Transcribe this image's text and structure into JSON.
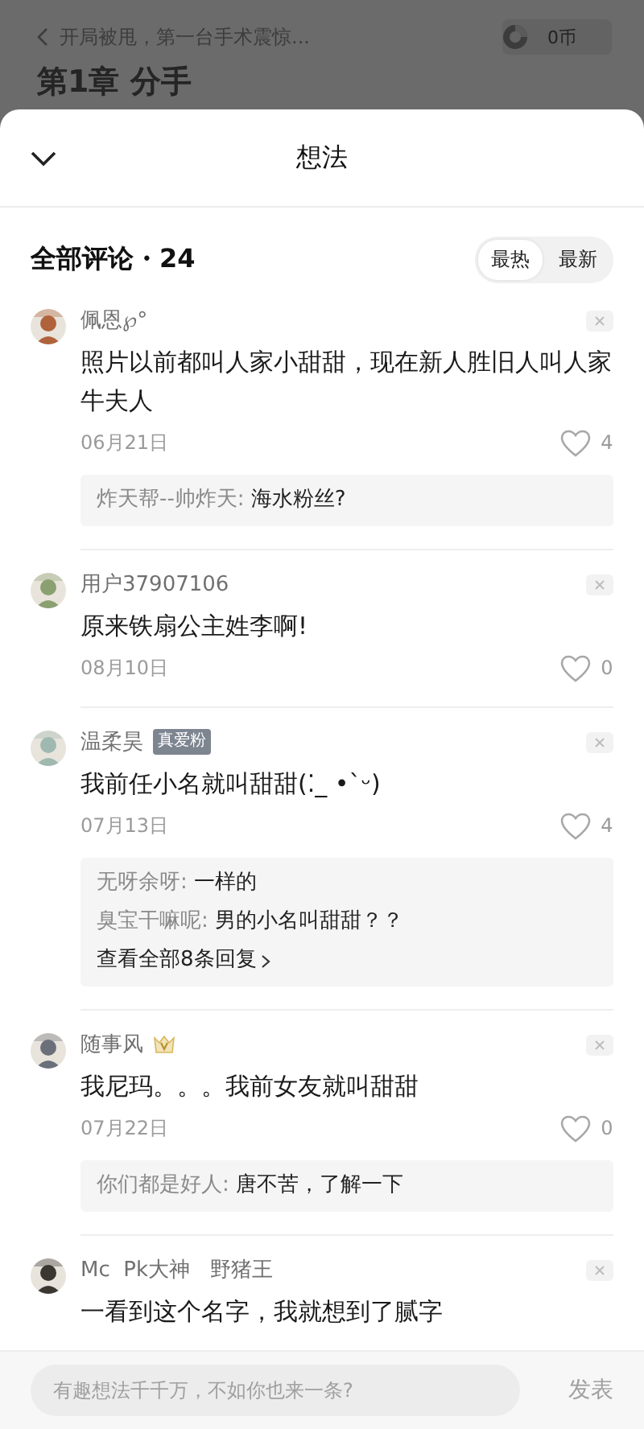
{
  "background": {
    "book_title": "开局被甩，第一台手术震惊...",
    "coins": "0币",
    "chapter_title": "第1章 分手"
  },
  "sheet": {
    "title": "想法",
    "section_title": "全部评论・24",
    "sort_tabs": [
      {
        "label": "最热",
        "selected": true
      },
      {
        "label": "最新",
        "selected": false
      }
    ],
    "comments": [
      {
        "user": "佩恩℘°",
        "text": "照片以前都叫人家小甜甜，现在新人胜旧人叫人家牛夫人",
        "date": "06月21日",
        "likes": "4",
        "replies": [
          {
            "user": "炸天帮--帅炸天:",
            "text": "海水粉丝?"
          }
        ]
      },
      {
        "user": "用户37907106",
        "text": "原来铁扇公主姓李啊!",
        "date": "08月10日",
        "likes": "0"
      },
      {
        "user": "温柔昊",
        "badge": {
          "kind": "text",
          "label": "真爱粉"
        },
        "text": "我前任小名就叫甜甜(⁚_ •`ᵕ)",
        "date": "07月13日",
        "likes": "4",
        "replies": [
          {
            "user": "无呀余呀:",
            "text": "一样的"
          },
          {
            "user": "臭宝干嘛呢:",
            "text": "男的小名叫甜甜？？"
          }
        ],
        "more": "查看全部8条回复"
      },
      {
        "user": "随事风",
        "badge": {
          "kind": "crown"
        },
        "text": "我尼玛。。。我前女友就叫甜甜",
        "date": "07月22日",
        "likes": "0",
        "replies": [
          {
            "user": "你们都是好人:",
            "text": "唐不苦，了解一下"
          }
        ]
      },
      {
        "user": "Mc  Pk大神   野猪王",
        "text": "一看到这个名字，我就想到了腻字"
      }
    ],
    "composer": {
      "placeholder": "有趣想法千千万，不如你也来一条?",
      "submit": "发表"
    }
  }
}
